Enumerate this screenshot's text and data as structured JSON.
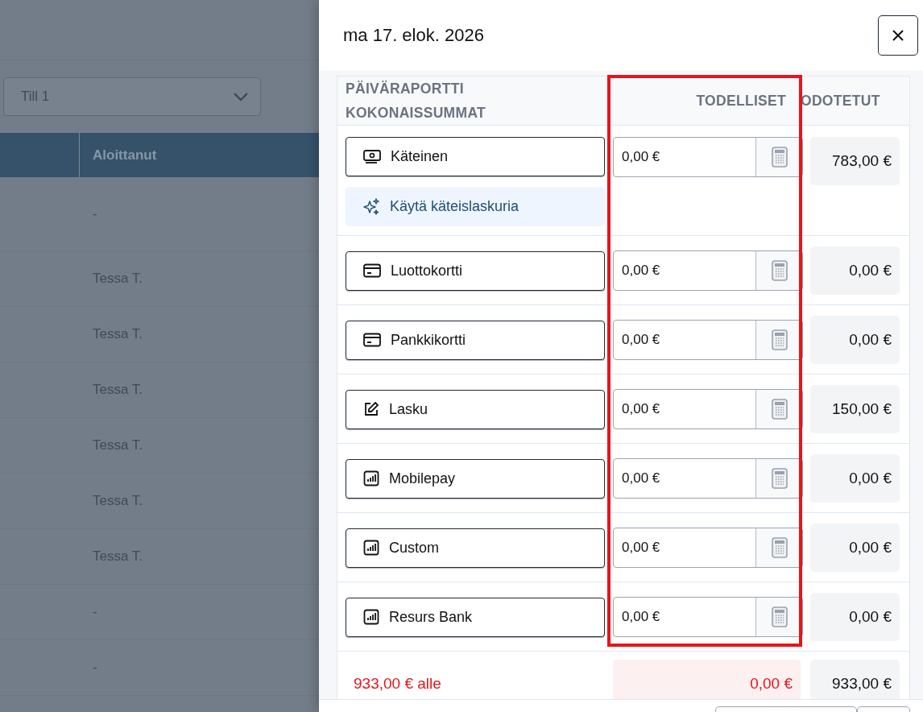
{
  "background_page": {
    "till_select": {
      "value": "Till 1"
    },
    "table": {
      "columns": [
        "Aloittanut"
      ],
      "rows": [
        "-",
        "Tessa T.",
        "Tessa T.",
        "Tessa T.",
        "Tessa T.",
        "Tessa T.",
        "Tessa T.",
        "-",
        "-"
      ]
    }
  },
  "drawer": {
    "title": "ma 17. elok. 2026",
    "columns": [
      {
        "label": "PÄIVÄRAPORTTI KOKONAISSUMMAT",
        "highlighted": false
      },
      {
        "label": "TODELLISET",
        "highlighted": true
      },
      {
        "label": "ODOTETUT",
        "highlighted": false
      }
    ],
    "methods": [
      {
        "label": "Käteinen",
        "kind": "cash",
        "actual": "0,00 €",
        "expected": "783,00 €",
        "helper": "Käytä käteislaskuria"
      },
      {
        "label": "Luottokortti",
        "kind": "card",
        "actual": "0,00 €",
        "expected": "0,00 €"
      },
      {
        "label": "Pankkikortti",
        "kind": "card",
        "actual": "0,00 €",
        "expected": "0,00 €"
      },
      {
        "label": "Lasku",
        "kind": "invoice",
        "actual": "0,00 €",
        "expected": "150,00 €"
      },
      {
        "label": "Mobilepay",
        "kind": "other",
        "actual": "0,00 €",
        "expected": "0,00 €"
      },
      {
        "label": "Custom",
        "kind": "other",
        "actual": "0,00 €",
        "expected": "0,00 €"
      },
      {
        "label": "Resurs Bank",
        "kind": "other",
        "actual": "0,00 €",
        "expected": "0,00 €"
      }
    ],
    "total": {
      "difference": "933,00 € alle",
      "actual": "0,00 €",
      "expected": "933,00 €",
      "short": true
    }
  }
}
